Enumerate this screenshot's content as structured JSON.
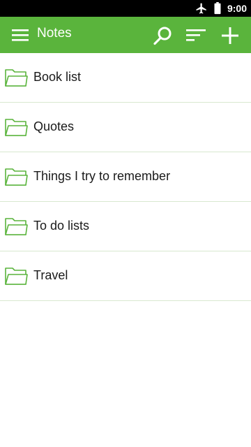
{
  "status_bar": {
    "time": "9:00",
    "icons": [
      "airplane-mode-icon",
      "battery-icon"
    ]
  },
  "app_bar": {
    "title": "Notes",
    "actions": [
      "menu-icon",
      "search-icon",
      "sort-icon",
      "add-icon"
    ]
  },
  "colors": {
    "accent": "#5ab43c",
    "status_bar": "#000000",
    "text": "#1a1a1a",
    "divider": "#d8e8cf"
  },
  "folders": [
    {
      "label": "Book list",
      "icon": "folder-icon"
    },
    {
      "label": "Quotes",
      "icon": "folder-icon"
    },
    {
      "label": "Things I try to remember",
      "icon": "folder-icon"
    },
    {
      "label": "To do lists",
      "icon": "folder-icon"
    },
    {
      "label": "Travel",
      "icon": "folder-icon"
    }
  ]
}
